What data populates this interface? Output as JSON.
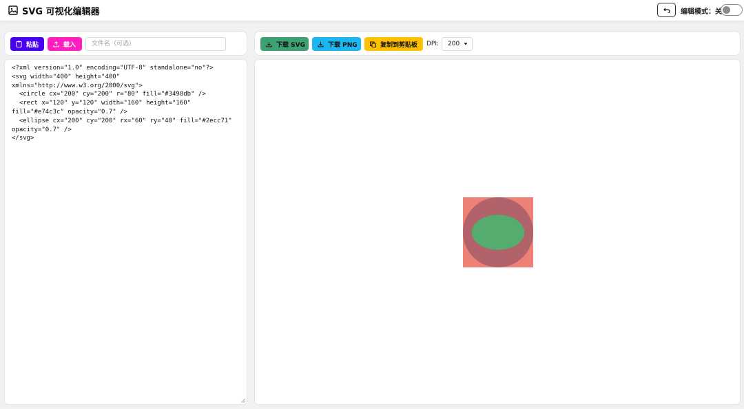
{
  "header": {
    "title": "SVG 可视化编辑器",
    "app_icon": "image-icon",
    "undo_icon": "undo-icon",
    "mode_label": "编辑模式：关",
    "mode_on": false
  },
  "source_toolbar": {
    "paste_label": "粘贴",
    "paste_icon": "clipboard-icon",
    "load_label": "载入",
    "load_icon": "upload-icon",
    "filename_placeholder": "文件名（可选）",
    "filename_value": ""
  },
  "export_toolbar": {
    "download_svg_label": "下载 SVG",
    "download_png_label": "下载 PNG",
    "download_icon": "download-icon",
    "copy_label": "复制到剪贴板",
    "copy_icon": "copy-icon",
    "dpi_label": "DPI:",
    "dpi_value": "200"
  },
  "editor": {
    "code": "<?xml version=\"1.0\" encoding=\"UTF-8\" standalone=\"no\"?>\n<svg width=\"400\" height=\"400\"\nxmlns=\"http://www.w3.org/2000/svg\">\n  <circle cx=\"200\" cy=\"200\" r=\"80\" fill=\"#3498db\" />\n  <rect x=\"120\" y=\"120\" width=\"160\" height=\"160\"\nfill=\"#e74c3c\" opacity=\"0.7\" />\n  <ellipse cx=\"200\" cy=\"200\" rx=\"60\" ry=\"40\" fill=\"#2ecc71\"\nopacity=\"0.7\" />\n</svg>"
  },
  "colors": {
    "paste_button": "#4a00f0",
    "load_button": "#ff1ec0",
    "download_svg_button": "#3fa073",
    "download_png_button": "#1db6ef",
    "copy_button": "#ffc000",
    "circle_fill": "#3498db",
    "rect_fill": "#e74c3c",
    "ellipse_fill": "#2ecc71"
  }
}
